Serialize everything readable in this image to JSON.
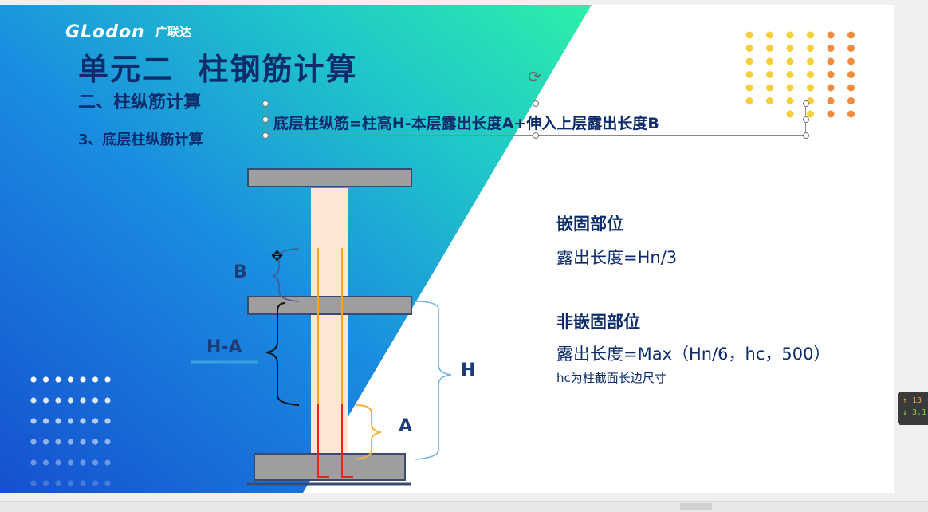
{
  "slide": {
    "logo_brand": "GLodon",
    "logo_cn": "广联达",
    "title": "单元二  柱钢筋计算",
    "subtitle_section": "二、柱纵筋计算",
    "subtitle_item": "3、底层柱纵筋计算",
    "formula": "底层柱纵筋=柱高H-本层露出长度A+伸入上层露出长度B",
    "embed_heading": "嵌固部位",
    "embed_formula": "露出长度=Hn/3",
    "nonembed_heading": "非嵌固部位",
    "nonembed_formula": "露出长度=Max（Hn/6，hc，500）",
    "nonembed_note": "hc为柱截面长边尺寸"
  },
  "diagram": {
    "label_b": "B",
    "label_ha": "H-A",
    "label_h": "H",
    "label_a": "A"
  },
  "side_widget": {
    "up_text": "↑ 13",
    "down_text": "↓ 3.1"
  },
  "colors": {
    "title": "#0d2c6c",
    "gradient_start": "#1660d8",
    "gradient_end": "#22e8b0",
    "rebar_orange": "#f5a623",
    "rebar_red": "#e0281c",
    "brace_blue": "#6fb3e0",
    "brace_orange": "#f5b041",
    "dot_yellow": "#f6d03c",
    "dot_orange": "#f08c40"
  }
}
